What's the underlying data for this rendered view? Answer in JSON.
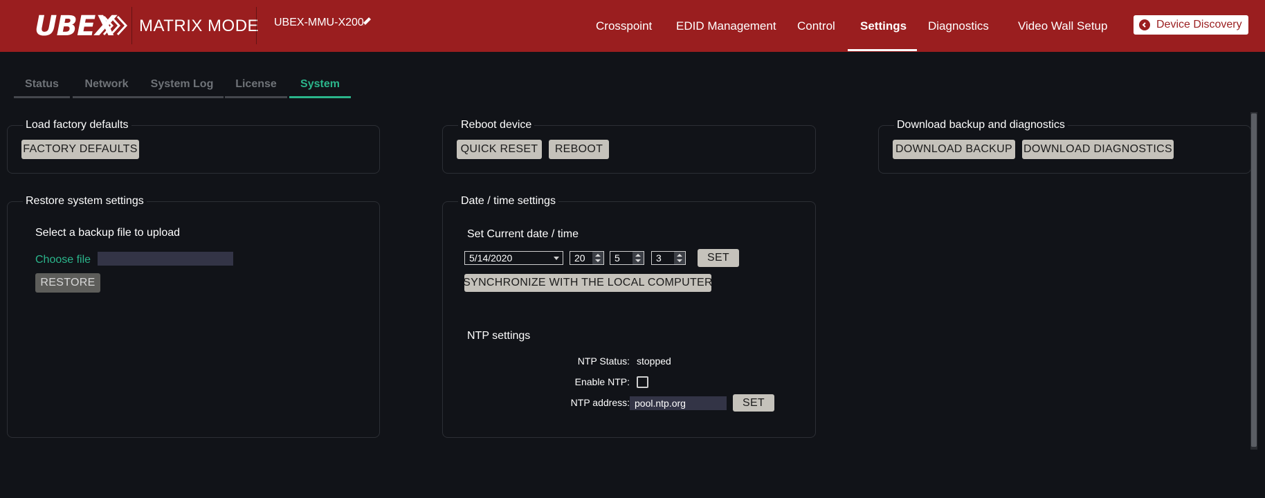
{
  "header": {
    "logo_text": "UBEX",
    "mode_title": "MATRIX MODE",
    "device_name": "UBEX-MMU-X200",
    "nav": [
      "Crosspoint",
      "EDID Management",
      "Control",
      "Settings",
      "Diagnostics",
      "Video Wall Setup"
    ],
    "active_nav": "Settings",
    "device_discovery": "Device Discovery",
    "colors": {
      "brand": "#9a1e1f",
      "accent": "#2bb58b"
    }
  },
  "tabs": [
    "Status",
    "Network",
    "System Log",
    "License",
    "System"
  ],
  "active_tab": "System",
  "factory": {
    "title": "Load factory defaults",
    "button": "FACTORY DEFAULTS"
  },
  "reboot": {
    "title": "Reboot device",
    "quick_reset": "QUICK RESET",
    "reboot": "REBOOT"
  },
  "backup": {
    "title": "Download backup and diagnostics",
    "download_backup": "DOWNLOAD BACKUP",
    "download_diagnostics": "DOWNLOAD DIAGNOSTICS"
  },
  "restore": {
    "title": "Restore system settings",
    "select_label": "Select a backup file to upload",
    "choose_file": "Choose file",
    "restore_button": "RESTORE"
  },
  "datetime": {
    "title": "Date / time settings",
    "set_current_label": "Set Current date / time",
    "date_value": "5/14/2020",
    "hour": "20",
    "minute": "5",
    "second": "3",
    "set_button": "SET",
    "sync_button": "SYNCHRONIZE WITH THE LOCAL COMPUTER",
    "ntp_title": "NTP settings",
    "ntp_status_label": "NTP Status:",
    "ntp_status_value": "stopped",
    "enable_ntp_label": "Enable NTP:",
    "enable_ntp_checked": false,
    "ntp_address_label": "NTP address:",
    "ntp_address_value": "pool.ntp.org",
    "ntp_set_button": "SET"
  }
}
